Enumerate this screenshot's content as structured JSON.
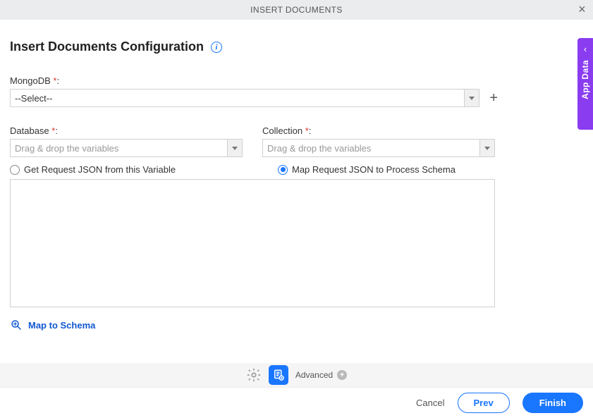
{
  "titlebar": {
    "title": "INSERT DOCUMENTS"
  },
  "page": {
    "heading": "Insert Documents Configuration"
  },
  "form": {
    "mongo_label": "MongoDB ",
    "mongo_value": "--Select--",
    "database_label": "Database ",
    "database_placeholder": "Drag & drop the variables",
    "collection_label": "Collection ",
    "collection_placeholder": "Drag & drop the variables",
    "required_suffix": ":",
    "radio_get_label": "Get Request JSON from this Variable",
    "radio_map_label": "Map Request JSON to Process Schema",
    "map_schema_label": "Map to Schema"
  },
  "toolbar": {
    "advanced_label": "Advanced"
  },
  "footer": {
    "cancel": "Cancel",
    "prev": "Prev",
    "finish": "Finish"
  },
  "side_panel": {
    "label": "App Data"
  }
}
